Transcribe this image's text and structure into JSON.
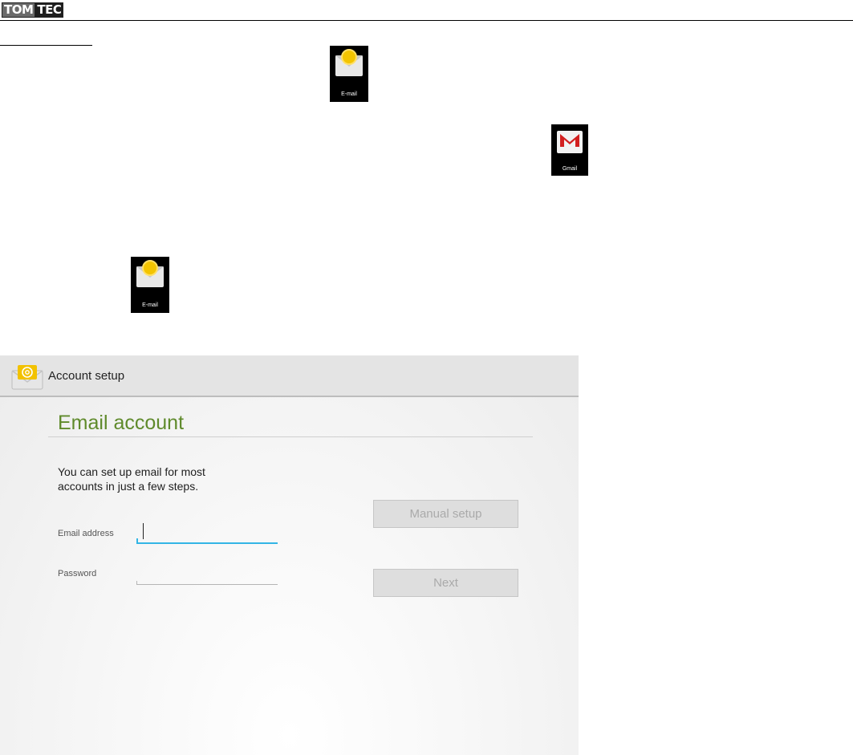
{
  "header": {
    "logo_part1": "TOM",
    "logo_part2": "TEC"
  },
  "icons": {
    "email_label": "E-mail",
    "gmail_label": "Gmail"
  },
  "screen": {
    "action_bar_title": "Account setup",
    "heading": "Email account",
    "intro": "You can set up email for most accounts in just a few steps.",
    "email_label": "Email address",
    "email_value": "",
    "password_label": "Password",
    "password_value": "",
    "manual_setup_label": "Manual setup",
    "next_label": "Next",
    "accent_color": "#33b5e5",
    "heading_color": "#5f8a2b"
  }
}
